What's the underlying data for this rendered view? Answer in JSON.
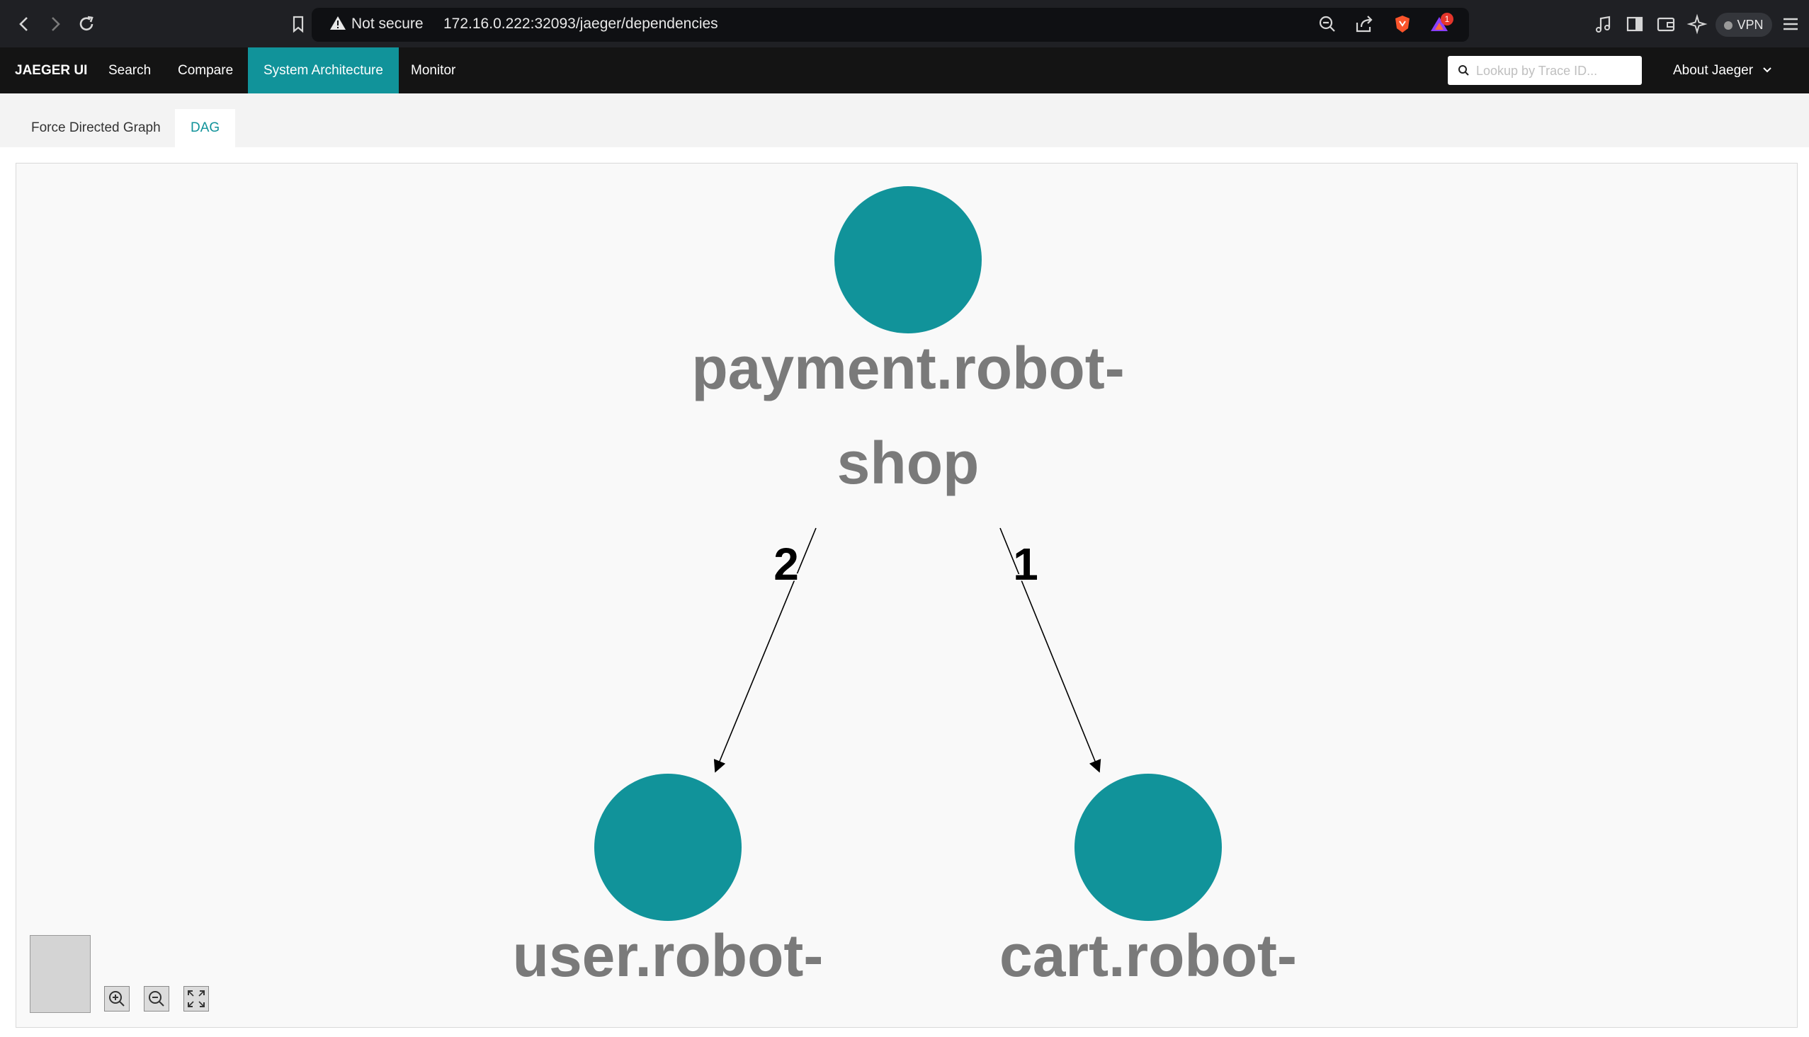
{
  "browser": {
    "security_label": "Not secure",
    "url": "172.16.0.222:32093/jaeger/dependencies",
    "notification_count": "1",
    "vpn_label": "VPN"
  },
  "nav": {
    "brand": "JAEGER UI",
    "items": [
      "Search",
      "Compare",
      "System Architecture",
      "Monitor"
    ],
    "active": "System Architecture",
    "search_placeholder": "Lookup by Trace ID...",
    "about": "About Jaeger"
  },
  "tabs": {
    "items": [
      "Force Directed Graph",
      "DAG"
    ],
    "active": "DAG"
  },
  "graph": {
    "nodes": [
      {
        "id": "payment",
        "label_lines": [
          "payment.robot-",
          "shop"
        ]
      },
      {
        "id": "user",
        "label_lines": [
          "user.robot-"
        ]
      },
      {
        "id": "cart",
        "label_lines": [
          "cart.robot-"
        ]
      }
    ],
    "edges": [
      {
        "from": "payment",
        "to": "user",
        "label": "2"
      },
      {
        "from": "payment",
        "to": "cart",
        "label": "1"
      }
    ],
    "colors": {
      "node": "#11939a",
      "label": "#7a7a7a",
      "edge": "#000000"
    }
  },
  "controls": {
    "zoom_in": "zoom-in-icon",
    "zoom_out": "zoom-out-icon",
    "fit": "fit-view-icon"
  }
}
